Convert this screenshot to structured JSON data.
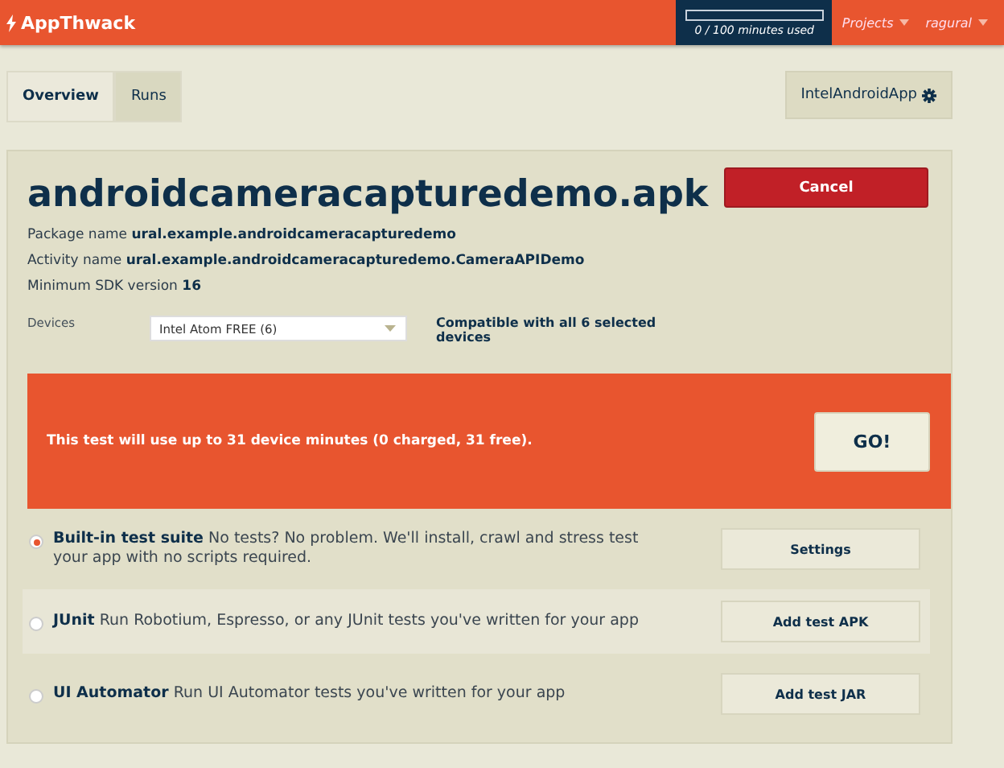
{
  "header": {
    "logo": "AppThwack",
    "usage": {
      "level": 0,
      "reading": "0 / 100 minutes used"
    },
    "menus": [
      {
        "label": "Projects"
      },
      {
        "label": "ragural"
      }
    ]
  },
  "tabs": [
    {
      "label": "Overview",
      "selected": true
    },
    {
      "label": "Runs",
      "selected": false
    }
  ],
  "project_button": "IntelAndroidApp",
  "app": {
    "title": "androidcameracapturedemo.apk",
    "cancel": "Cancel",
    "info": [
      {
        "label": "Package name",
        "value": "ural.example.androidcameracapturedemo"
      },
      {
        "label": "Activity name",
        "value": "ural.example.androidcameracapturedemo.CameraAPIDemo"
      },
      {
        "label": "Minimum SDK version",
        "value": "16"
      }
    ],
    "devices": {
      "label": "Devices",
      "value": "Intel Atom FREE (6)",
      "note": "Compatible with all 6 selected devices"
    }
  },
  "banner": {
    "text": "This test will use up to 31 device minutes (0 charged, 31 free).",
    "button": "GO!"
  },
  "options": [
    {
      "text": "**Built-in test suite** No tests? No problem. We'll install, crawl and stress test your app with no scripts required.",
      "selected": true,
      "button": "Settings"
    },
    {
      "text": "**JUnit** Run Robotium, Espresso, or any JUnit tests you've written for your app",
      "selected": false,
      "button": "Add test APK"
    },
    {
      "text": "**UI Automator** Run UI Automator tests you've written for your app",
      "selected": false,
      "button": "Add test JAR"
    }
  ]
}
